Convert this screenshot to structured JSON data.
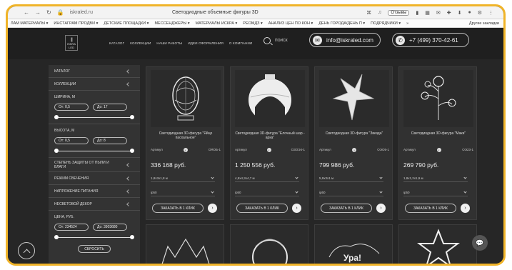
{
  "browser": {
    "url": "iskraled.ru",
    "tab_title": "Светодиодные объемные фигуры 3D",
    "reviews_label": "Отзывы",
    "bookmarks": [
      "ЛАМ МАТЕРИАЛЫ ▾",
      "ИНСТАГРАМ ПРОДВИ ▾",
      "ДЕТСКИЕ ПЛОЩАДКИ ▾",
      "МЕССЕНДЖЕРЫ ▾",
      "МАТЕРИАЛЫ ИСКРА ▾",
      "РЕОМДЗ ▾",
      "АНАЛИЗ ЦЕН ПО КОН ▾",
      "ДЕНЬ ГОРОДА/ДЕНЬ П ▾",
      "ПОДРЯДЧИКИ ▾",
      "»"
    ],
    "other_bookmarks": "Другие закладки"
  },
  "header": {
    "logo_text": "ISKRA LED",
    "nav": [
      "КАТАЛОГ",
      "КОЛЛЕКЦИИ",
      "НАШИ РАБОТЫ",
      "ИДЕИ ОФОРМЛЕНИЯ",
      "О КОМПАНИИ"
    ],
    "search_label": "ПОИСК",
    "email": "info@iskraled.com",
    "phone": "+7 (499) 370-42-61"
  },
  "sidebar": {
    "catalog": "КАТАЛОГ",
    "collections": "КОЛЛЕКЦИИ",
    "width_label": "ШИРИНА, М",
    "width_from": "От: 0,5",
    "width_to": "До: 17",
    "height_label": "ВЫСОТА, М",
    "height_from": "От: 0,5",
    "height_to": "До: 8",
    "protection": "СТЕПЕНЬ ЗАЩИТЫ ОТ ПЫЛИ И ВЛАГИ",
    "glow_mode": "РЕЖИМ СВЕЧЕНИЯ",
    "voltage": "НАПРЯЖЕНИЕ ПИТАНИЯ",
    "nonlight": "НЕСВЕТОВОЙ ДЕКОР",
    "price_label": "ЦЕНА, РУБ.",
    "price_from": "От: 234524",
    "price_to": "До: 3903680",
    "reset": "СБРОСИТЬ"
  },
  "products": [
    {
      "name": "Светодиодная 3D-фигура \"Яйцо пасхальное\"",
      "article_label": "Артикул",
      "article": "ОЯОБ-1",
      "price": "336 168 руб.",
      "size": "1,8х3х1,8 м",
      "ip": "ip50",
      "order": "ЗАКАЗАТЬ В 1 КЛИК"
    },
    {
      "name": "Светодиодная 3D-фигура \"Елочный шар - арка\"",
      "article_label": "Артикул",
      "article": "ОЗОЭ4-1",
      "price": "1 250 556 руб.",
      "size": "4,9х4,3х4,7 м",
      "ip": "ip50",
      "order": "ЗАКАЗАТЬ В 1 КЛИК"
    },
    {
      "name": "Светодиодная 3D-фигура \"Звезда\"",
      "article_label": "Артикул",
      "article": "ОЭО5-1",
      "price": "799 986 руб.",
      "size": "5,9х3х1 м",
      "ip": "ip50",
      "order": "ЗАКАЗАТЬ В 1 КЛИК"
    },
    {
      "name": "Светодиодная 3D-фигура \"Маки\"",
      "article_label": "Артикул",
      "article": "ОЭ23-1",
      "price": "269 790 руб.",
      "size": "1,8х1,2х1,9 м",
      "ip": "ip50",
      "order": "ЗАКАЗАТЬ В 1 КЛИК"
    }
  ],
  "bottom_card_texts": [
    "",
    "",
    "Ура!",
    ""
  ]
}
